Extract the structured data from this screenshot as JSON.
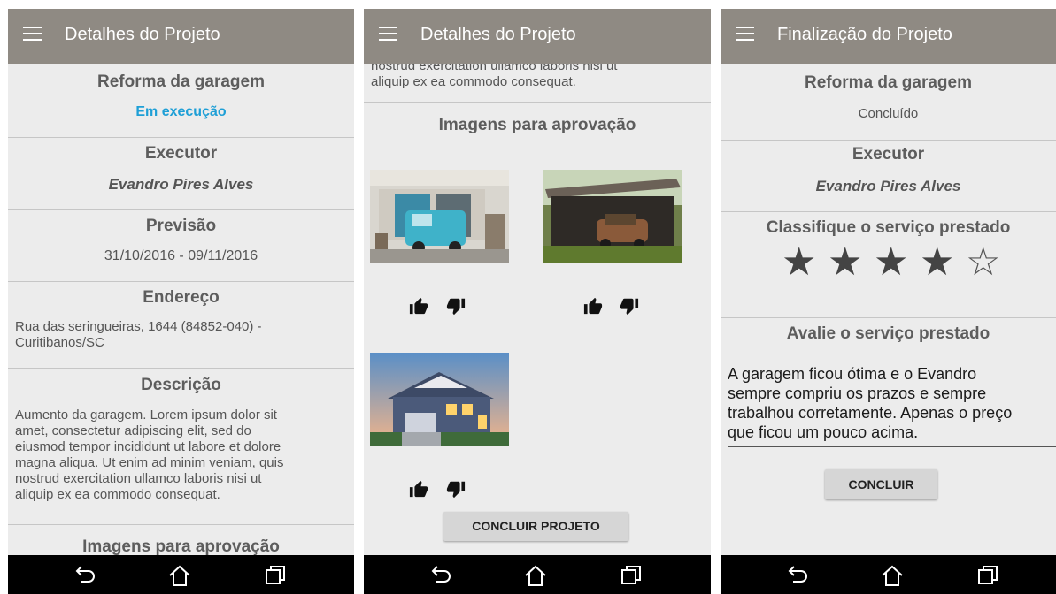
{
  "screen1": {
    "app_bar_title": "Detalhes do Projeto",
    "project_title": "Reforma da garagem",
    "status": "Em execução",
    "executor_heading": "Executor",
    "executor_name": "Evandro Pires Alves",
    "forecast_heading": "Previsão",
    "forecast_dates": "31/10/2016 - 09/11/2016",
    "address_heading": "Endereço",
    "address_line1": "Rua das seringueiras, 1644 (84852-040) -",
    "address_line2": "Curitibanos/SC",
    "description_heading": "Descrição",
    "description_lines": [
      "Aumento da garagem. Lorem ipsum dolor sit",
      "amet, consectetur adipiscing elit, sed do",
      "eiusmod tempor incididunt ut labore et dolore",
      "magna aliqua. Ut enim ad minim veniam, quis",
      "nostrud exercitation ullamco laboris nisi ut",
      "aliquip ex ea commodo consequat."
    ],
    "images_heading": "Imagens para aprovação"
  },
  "screen2": {
    "app_bar_title": "Detalhes do Projeto",
    "description_tail_lines": [
      "nostrud exercitation ullamco laboris nisi ut",
      "aliquip ex ea commodo consequat."
    ],
    "images_heading": "Imagens para aprovação",
    "images": [
      {
        "icon": "garage-with-van-photo"
      },
      {
        "icon": "old-shed-with-car-photo"
      },
      {
        "icon": "house-garage-photo"
      }
    ],
    "conclude_button": "CONCLUIR PROJETO"
  },
  "screen3": {
    "app_bar_title": "Finalização do Projeto",
    "project_title": "Reforma da garagem",
    "status": "Concluído",
    "executor_heading": "Executor",
    "executor_name": "Evandro Pires Alves",
    "rating_heading": "Classifique o serviço prestado",
    "rating": 4,
    "rating_max": 5,
    "review_heading": "Avalie o serviço prestado",
    "review_lines": [
      "A garagem ficou ótima e o Evandro",
      "sempre compriu os prazos e sempre",
      "trabalhou corretamente. Apenas o preço",
      "que ficou um pouco acima."
    ],
    "conclude_button": "CONCLUIR"
  },
  "colors": {
    "app_bar": "#8f8a83",
    "status_in_progress": "#1e9fd6",
    "background": "#ececec",
    "nav_bar": "#000000"
  },
  "nav": {
    "back_icon": "back-icon",
    "home_icon": "home-icon",
    "recents_icon": "recents-icon"
  }
}
